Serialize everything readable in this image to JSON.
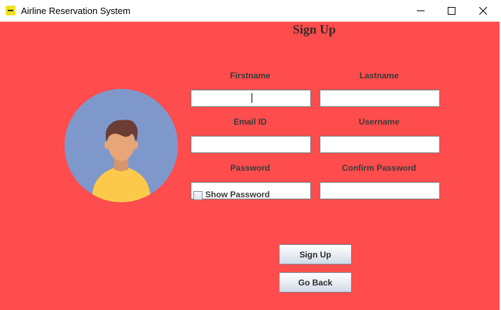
{
  "window": {
    "title": "Airline Reservation System",
    "controls": [
      "minimize",
      "maximize",
      "close"
    ]
  },
  "form": {
    "heading": "Sign Up",
    "fields": {
      "firstname": {
        "label": "Firstname",
        "value": ""
      },
      "lastname": {
        "label": "Lastname",
        "value": ""
      },
      "email": {
        "label": "Email ID",
        "value": ""
      },
      "username": {
        "label": "Username",
        "value": ""
      },
      "password": {
        "label": "Password",
        "value": ""
      },
      "confirm_password": {
        "label": "Confirm Password",
        "value": ""
      }
    },
    "show_password": {
      "label": "Show Password",
      "checked": false
    },
    "signup_button": "Sign Up",
    "goback_button": "Go Back"
  },
  "colors": {
    "background": "#ff4c4c",
    "avatar_circle": "#7f98cc",
    "shirt": "#fdc94b",
    "skin": "#e8a678",
    "hair": "#6b3d34"
  }
}
